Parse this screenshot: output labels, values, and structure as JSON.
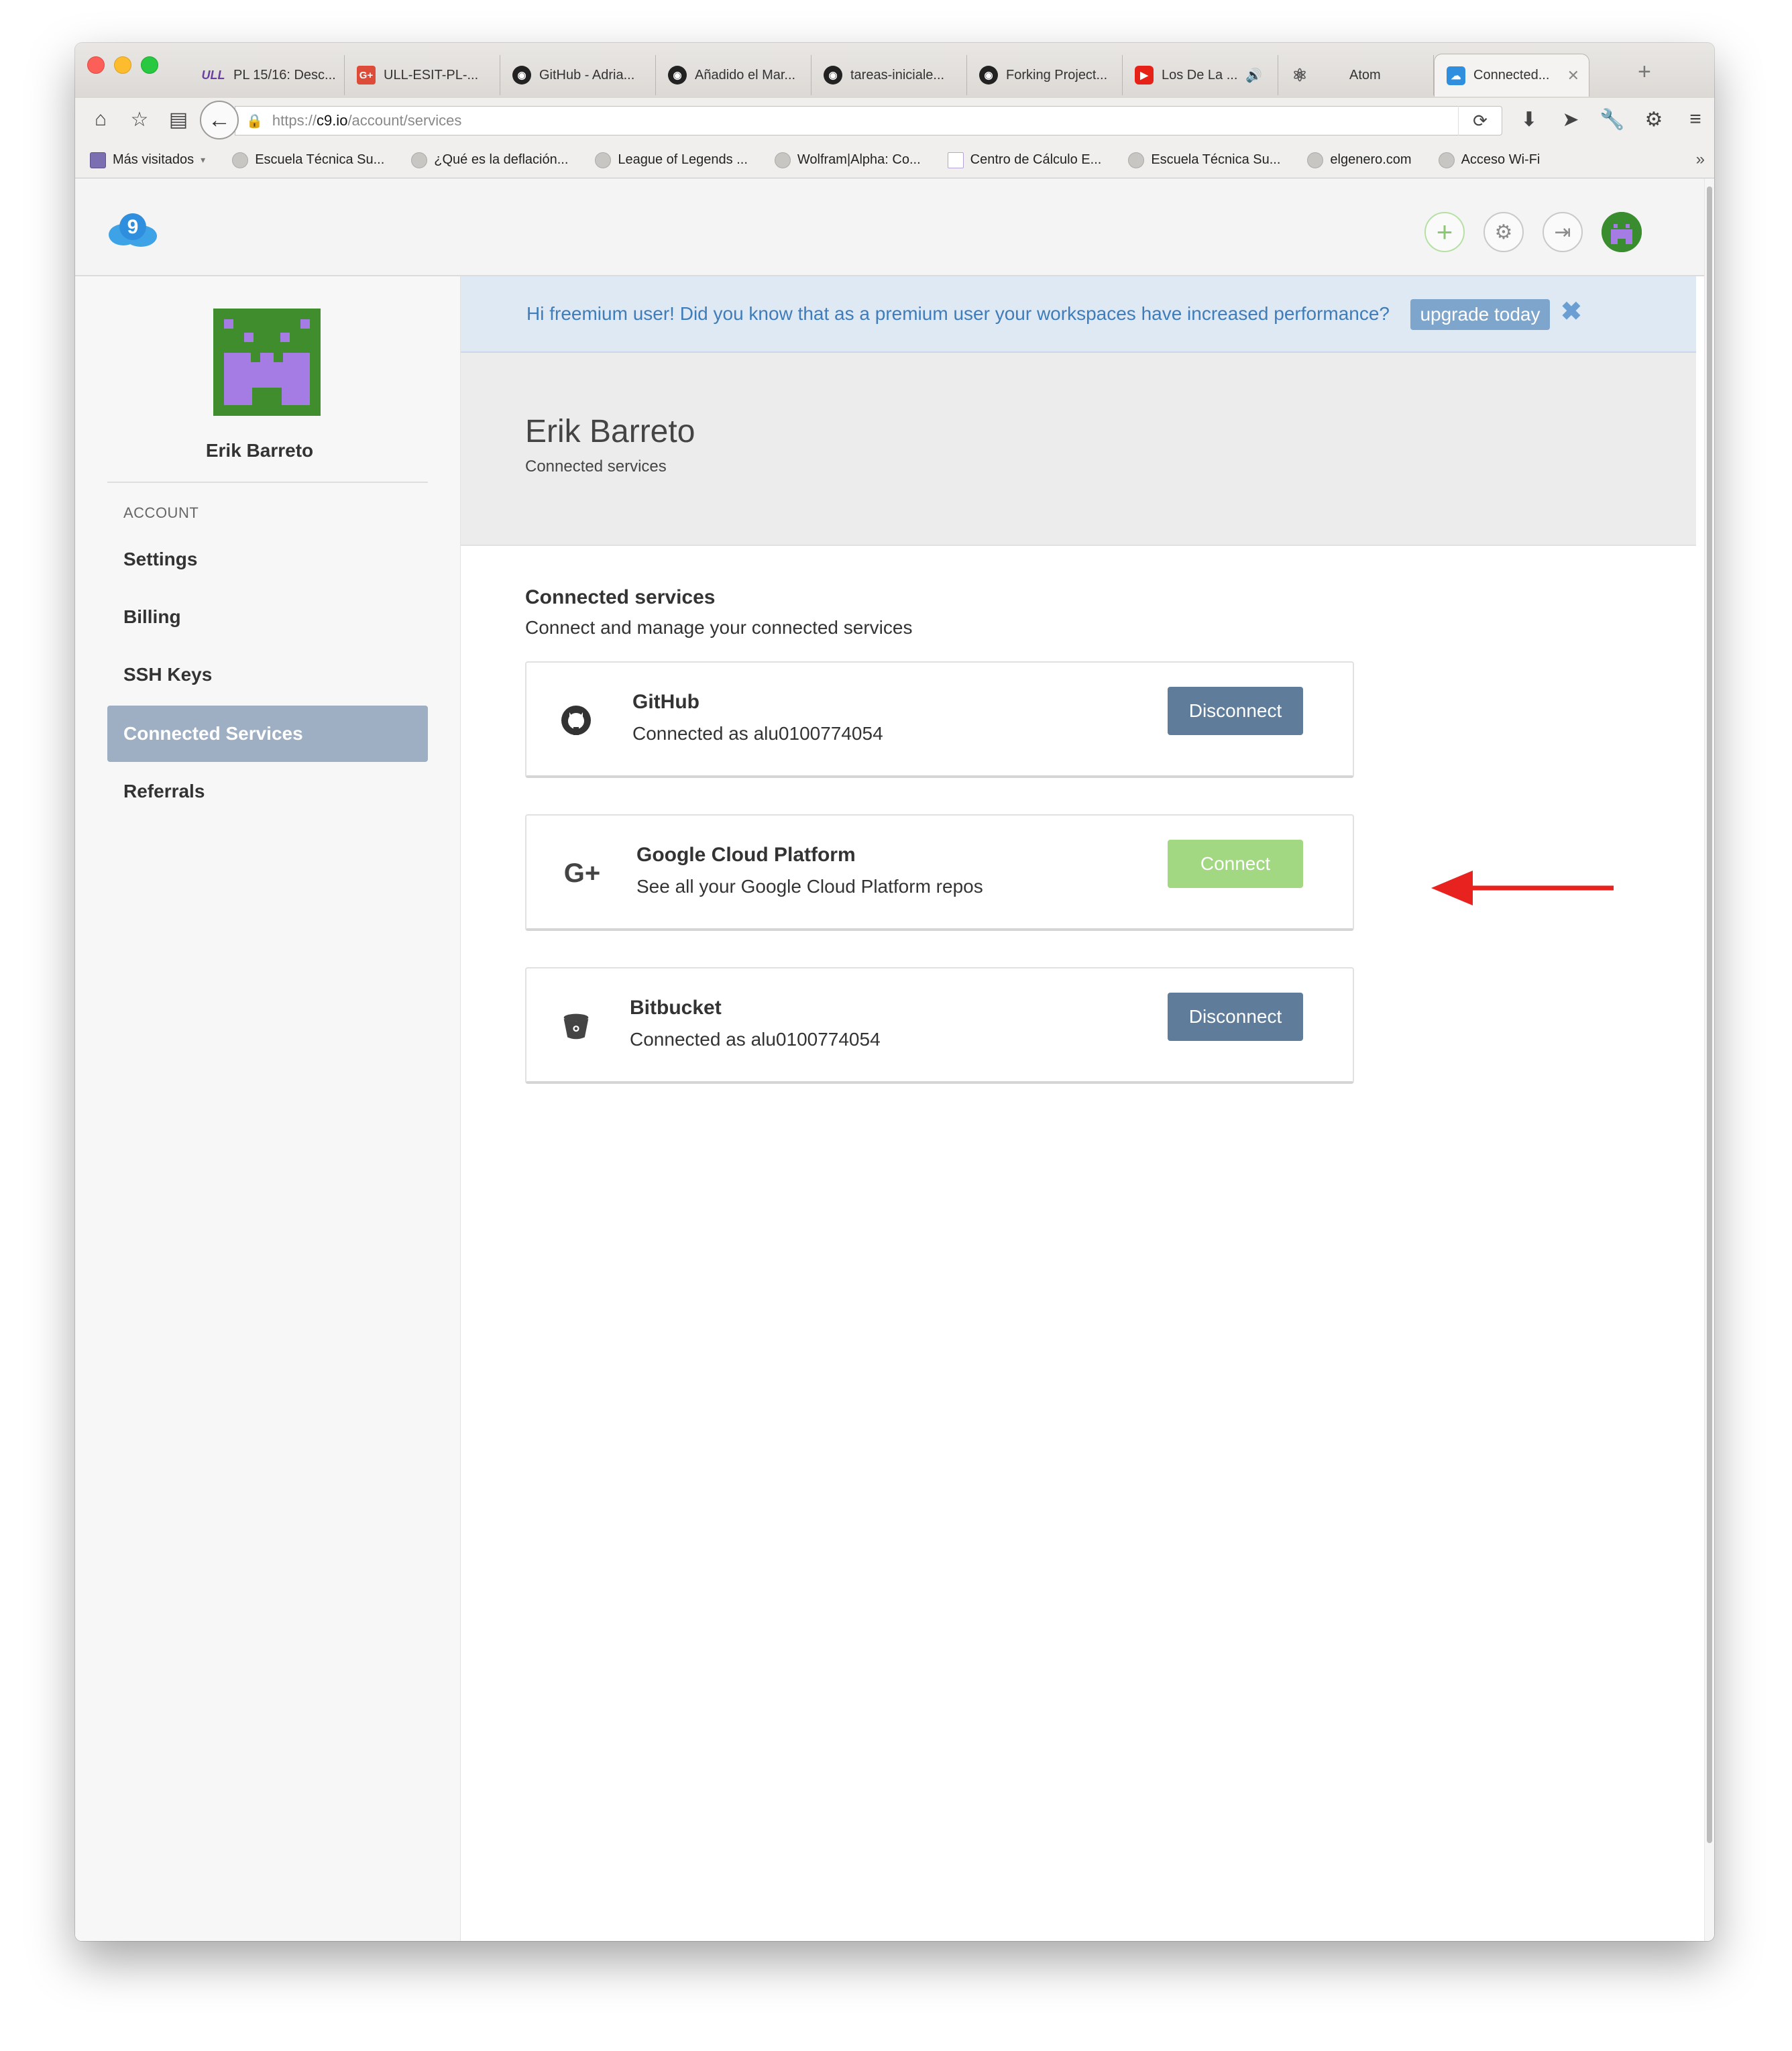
{
  "browser": {
    "tabs": [
      {
        "label": "PL 15/16: Desc...",
        "icon": "ull-icon"
      },
      {
        "label": "ULL-ESIT-PL-...",
        "icon": "google-plus-icon"
      },
      {
        "label": "GitHub - Adria...",
        "icon": "github-icon"
      },
      {
        "label": "Añadido el Mar...",
        "icon": "github-icon"
      },
      {
        "label": "tareas-iniciale...",
        "icon": "github-icon"
      },
      {
        "label": "Forking Project...",
        "icon": "github-icon"
      },
      {
        "label": "Los De La ...",
        "icon": "youtube-icon"
      },
      {
        "label": "Atom",
        "icon": "atom-icon"
      },
      {
        "label": "Connected...",
        "icon": "cloud9-icon",
        "active": true
      }
    ],
    "url": {
      "scheme": "https://",
      "host": "c9.io",
      "path": "/account/services"
    },
    "bookmarks": [
      {
        "label": "Más visitados",
        "icon": "folder-icon"
      },
      {
        "label": "Escuela Técnica Su...",
        "icon": "globe-icon"
      },
      {
        "label": "¿Qué es la deflación...",
        "icon": "globe-icon"
      },
      {
        "label": "League of Legends ...",
        "icon": "globe-icon"
      },
      {
        "label": "Wolfram|Alpha: Co...",
        "icon": "globe-icon"
      },
      {
        "label": "Centro de Cálculo E...",
        "icon": "ull-icon"
      },
      {
        "label": "Escuela Técnica Su...",
        "icon": "globe-icon"
      },
      {
        "label": "elgenero.com",
        "icon": "globe-icon"
      },
      {
        "label": "Acceso Wi-Fi",
        "icon": "globe-icon"
      }
    ]
  },
  "header": {
    "logo_text": "9"
  },
  "banner": {
    "text": "Hi freemium user! Did you know that as a premium user your workspaces have increased performance?",
    "button": "upgrade today",
    "close": "✖"
  },
  "sidebar": {
    "user_name": "Erik Barreto",
    "section_label": "ACCOUNT",
    "items": [
      {
        "label": "Settings"
      },
      {
        "label": "Billing"
      },
      {
        "label": "SSH Keys"
      },
      {
        "label": "Connected Services",
        "active": true
      },
      {
        "label": "Referrals"
      }
    ]
  },
  "profile": {
    "name": "Erik Barreto",
    "subtitle": "Connected services"
  },
  "services": {
    "title": "Connected services",
    "subtitle": "Connect and manage your connected services",
    "cards": [
      {
        "name": "GitHub",
        "detail": "Connected as alu0100774054",
        "button": "Disconnect",
        "icon": "github-icon"
      },
      {
        "name": "Google Cloud Platform",
        "detail": "See all your Google Cloud Platform repos",
        "button": "Connect",
        "icon": "google-plus-icon"
      },
      {
        "name": "Bitbucket",
        "detail": "Connected as alu0100774054",
        "button": "Disconnect",
        "icon": "bitbucket-icon"
      }
    ]
  },
  "colors": {
    "accent_blue": "#3f7cba",
    "disconnect": "#5f7d9a",
    "connect": "#a3d883",
    "sidebar_active": "#9eafc4",
    "arrow": "#e8231f"
  }
}
